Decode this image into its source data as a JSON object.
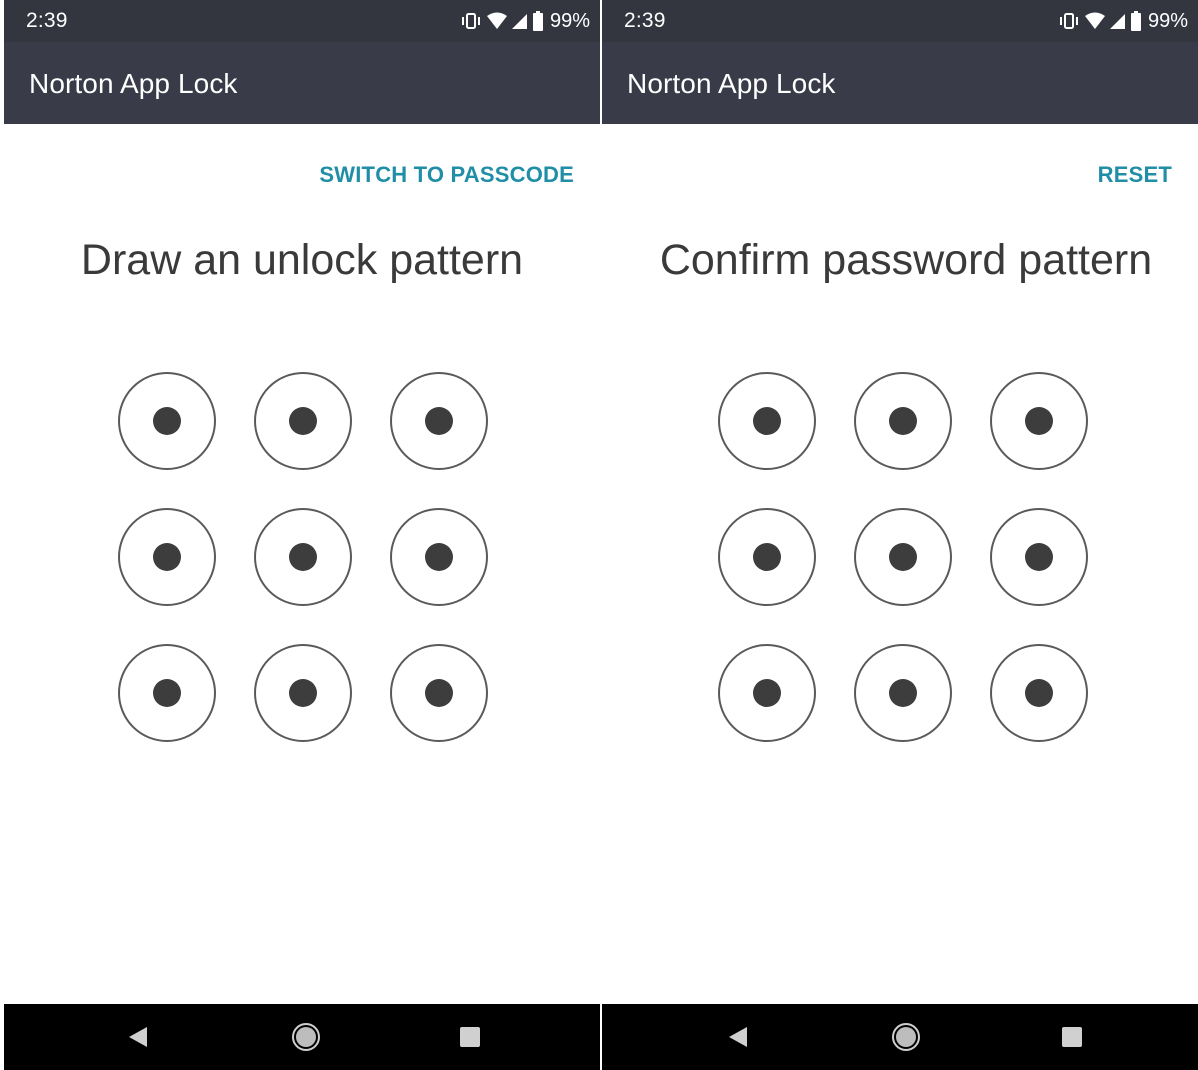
{
  "screens": [
    {
      "status": {
        "time": "2:39",
        "battery": "99%",
        "icons": [
          "vibrate-icon",
          "wifi-icon",
          "signal-icon",
          "battery-icon"
        ]
      },
      "app_title": "Norton App Lock",
      "action_label": "SWITCH TO PASSCODE",
      "prompt": "Draw an unlock pattern",
      "pattern_nodes": 9,
      "nav": [
        "back-icon",
        "home-icon",
        "recents-icon"
      ]
    },
    {
      "status": {
        "time": "2:39",
        "battery": "99%",
        "icons": [
          "vibrate-icon",
          "wifi-icon",
          "signal-icon",
          "battery-icon"
        ]
      },
      "app_title": "Norton App Lock",
      "action_label": "RESET",
      "prompt": "Confirm password pattern",
      "pattern_nodes": 9,
      "nav": [
        "back-icon",
        "home-icon",
        "recents-icon"
      ]
    }
  ],
  "colors": {
    "status_bar": "#33363f",
    "app_bar": "#393c48",
    "accent": "#1f8ea6",
    "prompt_text": "#3a3a3a",
    "dot": "#3d3d3d",
    "ring": "#5a5a5a",
    "nav_bar": "#000000"
  }
}
